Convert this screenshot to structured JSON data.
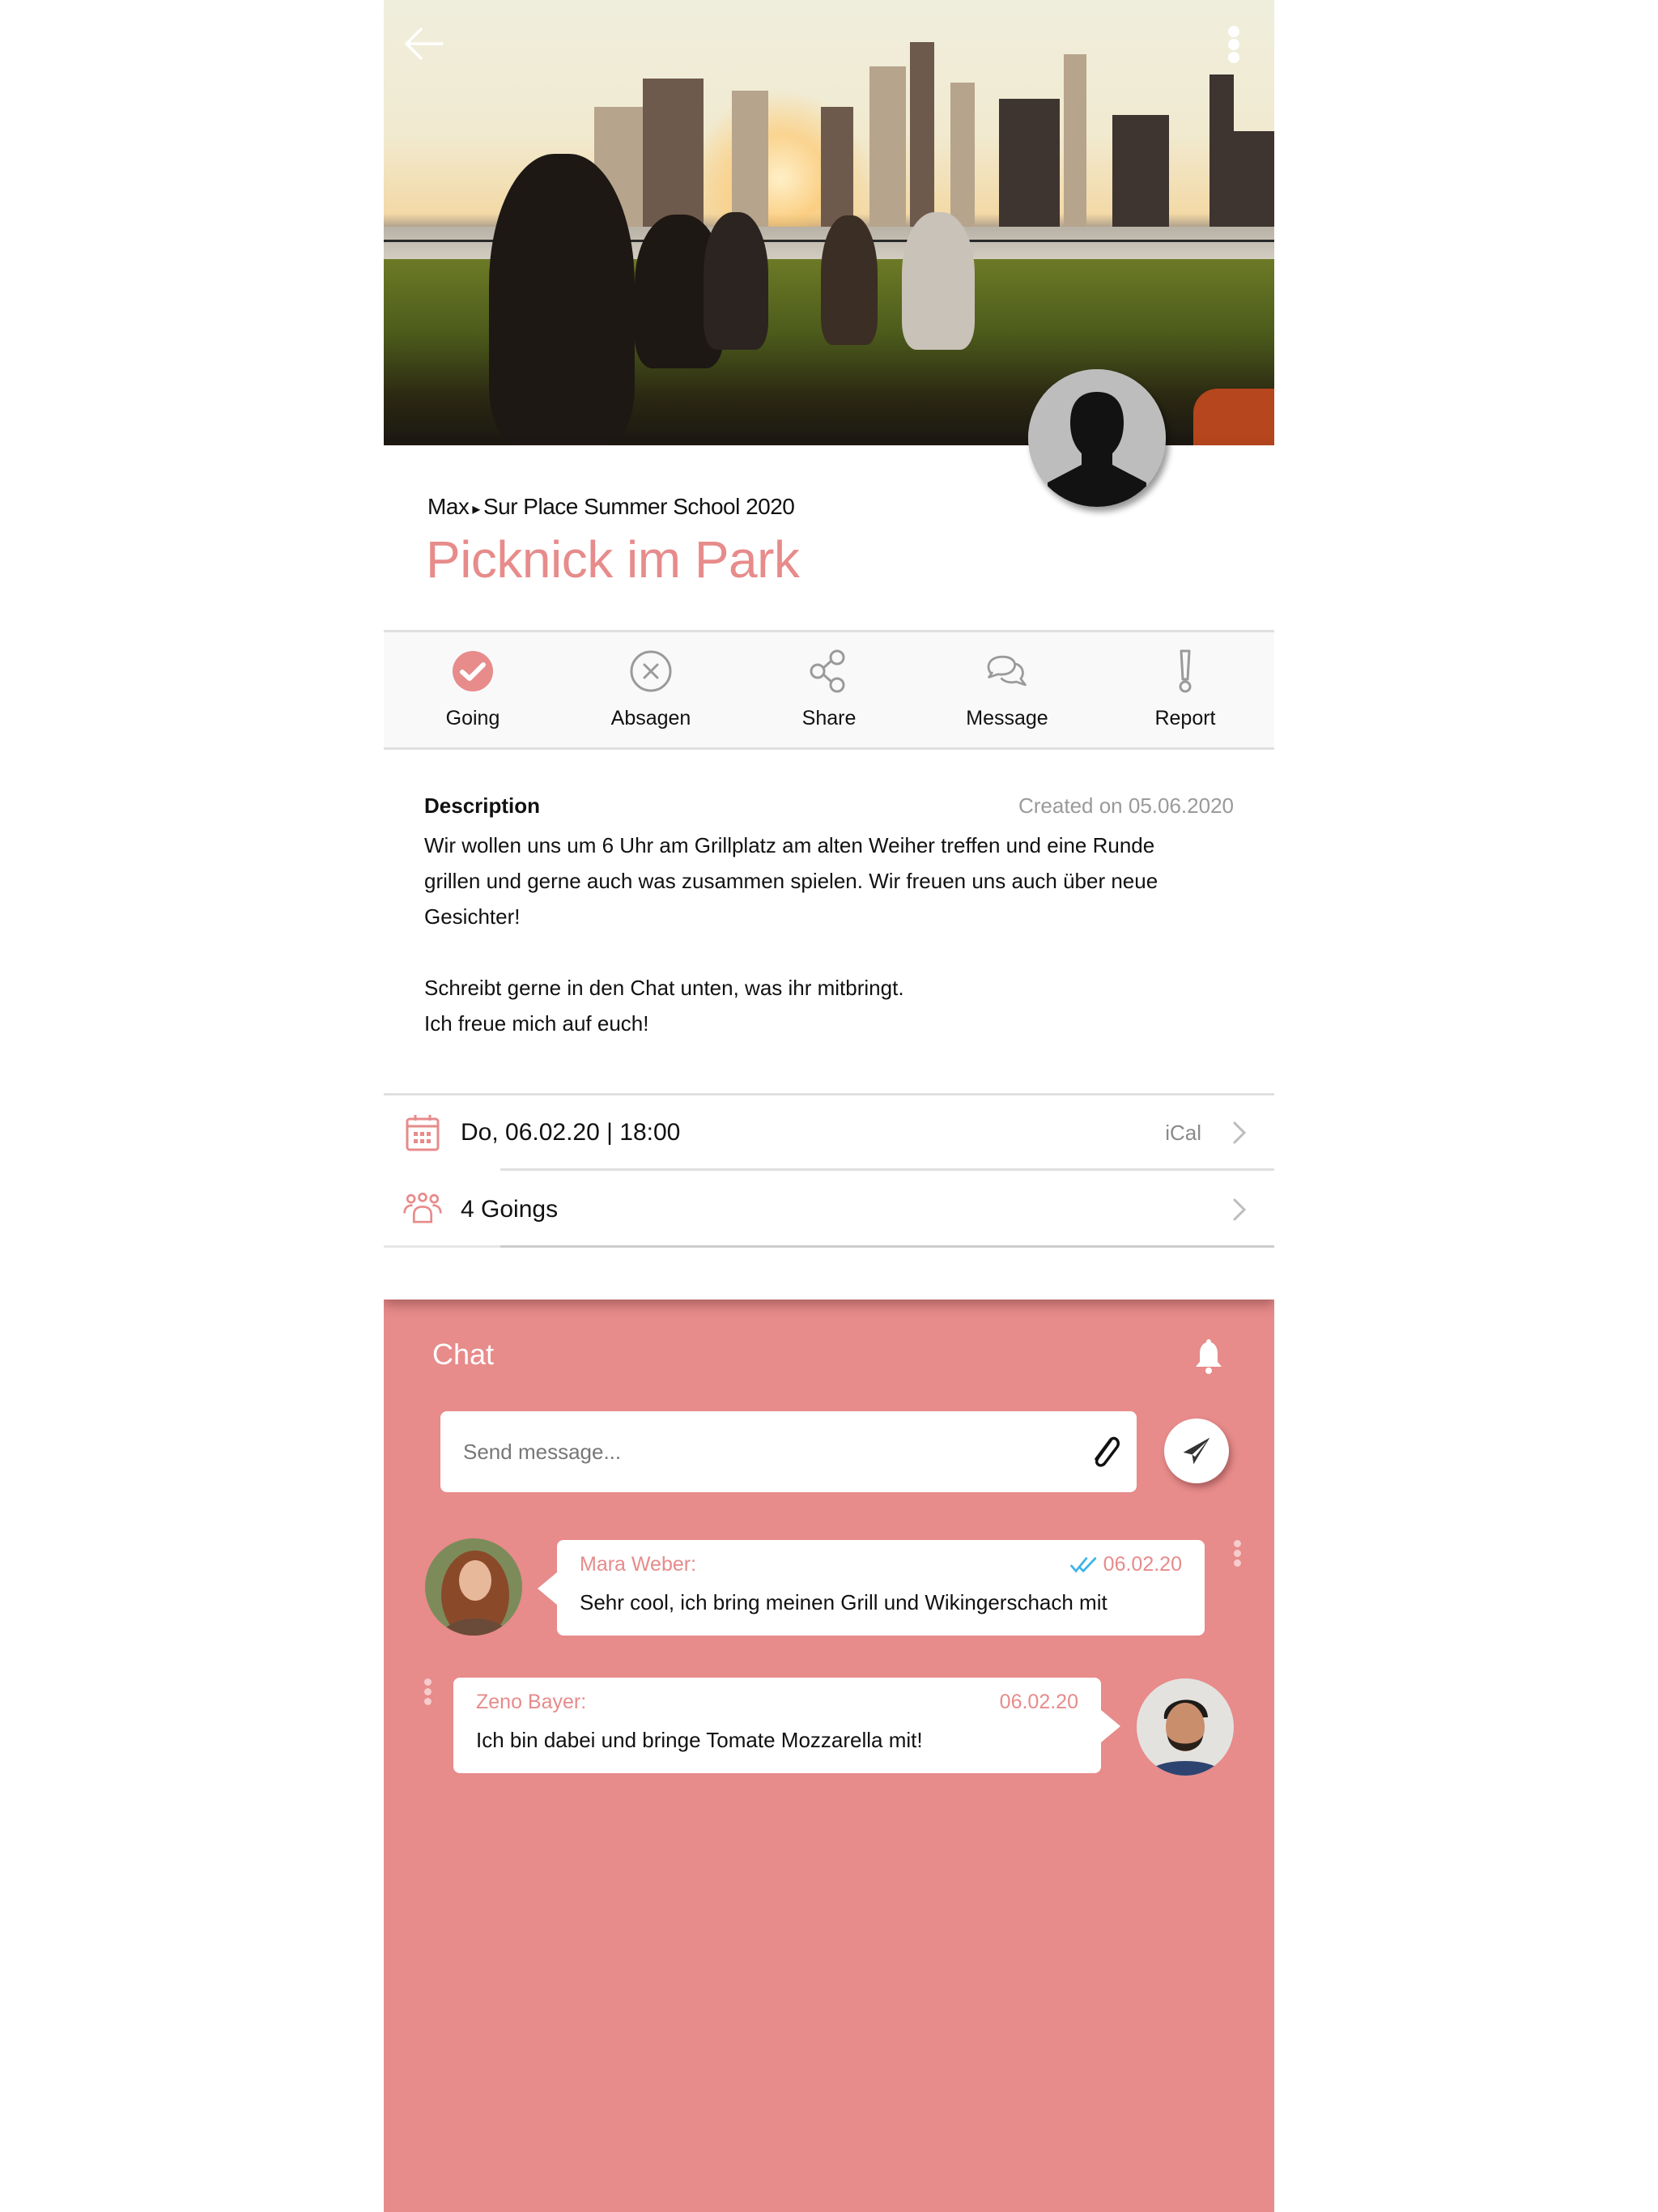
{
  "header": {
    "back_icon": "arrow-left-icon",
    "more_icon": "more-vertical-icon"
  },
  "event": {
    "breadcrumb_owner": "Max",
    "breadcrumb_separator": "▸",
    "breadcrumb_group": "Sur Place Summer School 2020",
    "title": "Picknick im Park"
  },
  "actions": [
    {
      "label": "Going",
      "icon": "check-circle-icon",
      "active": true
    },
    {
      "label": "Absagen",
      "icon": "x-circle-icon",
      "active": false
    },
    {
      "label": "Share",
      "icon": "share-icon",
      "active": false
    },
    {
      "label": "Message",
      "icon": "chat-bubbles-icon",
      "active": false
    },
    {
      "label": "Report",
      "icon": "exclamation-icon",
      "active": false
    }
  ],
  "description": {
    "heading": "Description",
    "created": "Created on 05.06.2020",
    "paragraphs": [
      "Wir wollen uns um 6 Uhr am Grillplatz am alten Weiher treffen und eine Runde",
      "grillen und gerne auch was zusammen spielen. Wir freuen uns auch über neue",
      "Gesichter!",
      "",
      "Schreibt gerne in den Chat unten, was ihr mitbringt.",
      "Ich freue mich auf euch!"
    ]
  },
  "info": {
    "date_text": "Do, 06.02.20 | 18:00",
    "date_action": "iCal",
    "goings_text": "4 Goings"
  },
  "chat": {
    "title": "Chat",
    "input_placeholder": "Send message...",
    "input_value": "",
    "messages": [
      {
        "author": "Mara Weber:",
        "date": "06.02.20",
        "text": "Sehr cool, ich bring meinen Grill und Wikingerschach mit",
        "read": true,
        "side": "left"
      },
      {
        "author": "Zeno Bayer:",
        "date": "06.02.20",
        "text": "Ich bin dabei und bringe Tomate Mozzarella mit!",
        "read": false,
        "side": "right"
      }
    ]
  },
  "colors": {
    "accent": "#e78b8b",
    "chat_background": "#e78b8b",
    "icon_gray": "#9a9a9a",
    "read_check": "#3db4e8"
  }
}
